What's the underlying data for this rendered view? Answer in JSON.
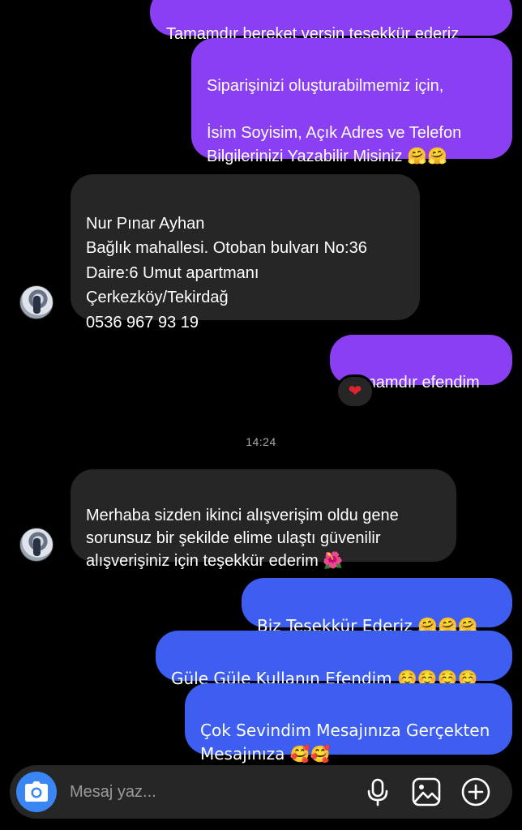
{
  "messages": {
    "m1": "Tamamdır bereket versin teşekkür ederiz",
    "m2": "Siparişinizi oluşturabilmemiz için,\n\nİsim Soyisim, Açık Adres ve Telefon\nBilgilerinizi Yazabilir Misiniz 🤗🤗",
    "m3": "Nur Pınar Ayhan\nBağlık mahallesi. Otoban bulvarı No:36\nDaire:6 Umut apartmanı\nÇerkezköy/Tekirdağ\n0536 967 93 19",
    "m4": "Tamamdır efendim",
    "m5": "Merhaba sizden ikinci alışverişim oldu gene\nsorunsuz bir şekilde elime ulaştı güvenilir\nalışverişiniz için teşekkür ederim 🌺",
    "m6": "Biz Teşekkür Ederiz 🤗🤗🤗",
    "m7": "Güle Güle Kullanın Efendim ☺️☺️☺️☺️",
    "m8": "Çok Sevindim Mesajınıza Gerçekten\nMesajınıza 🥰🥰"
  },
  "timestamp": "14:24",
  "reaction": "❤️",
  "composer": {
    "placeholder": "Mesaj yaz...",
    "icons": [
      "camera-icon",
      "microphone-icon",
      "gallery-icon",
      "plus-circle-icon"
    ]
  },
  "colors": {
    "outgoing_purple": "#8a3ff2",
    "outgoing_blue": "#3d5ef0",
    "incoming": "#262626",
    "camera_button": "#3a86f5"
  }
}
